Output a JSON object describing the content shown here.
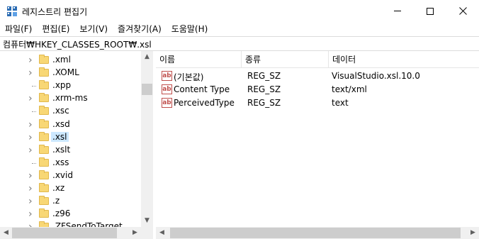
{
  "window": {
    "title": "레지스트리 편집기",
    "icon": "registry-editor-icon"
  },
  "menu": [
    "파일(F)",
    "편집(E)",
    "보기(V)",
    "즐겨찾기(A)",
    "도움말(H)"
  ],
  "address": "컴퓨터₩HKEY_CLASSES_ROOT₩.xsl",
  "tree": {
    "items": [
      {
        "label": ".xml",
        "expandable": true,
        "selected": false
      },
      {
        "label": ".XOML",
        "expandable": true,
        "selected": false
      },
      {
        "label": ".xpp",
        "expandable": false,
        "selected": false
      },
      {
        "label": ".xrm-ms",
        "expandable": true,
        "selected": false
      },
      {
        "label": ".xsc",
        "expandable": false,
        "selected": false
      },
      {
        "label": ".xsd",
        "expandable": true,
        "selected": false
      },
      {
        "label": ".xsl",
        "expandable": true,
        "selected": true
      },
      {
        "label": ".xslt",
        "expandable": true,
        "selected": false
      },
      {
        "label": ".xss",
        "expandable": false,
        "selected": false
      },
      {
        "label": ".xvid",
        "expandable": true,
        "selected": false
      },
      {
        "label": ".xz",
        "expandable": true,
        "selected": false
      },
      {
        "label": ".z",
        "expandable": true,
        "selected": false
      },
      {
        "label": ".z96",
        "expandable": true,
        "selected": false
      },
      {
        "label": ".ZFSendToTarget",
        "expandable": true,
        "selected": false
      }
    ]
  },
  "list": {
    "headers": {
      "name": "이름",
      "type": "종류",
      "data": "데이터"
    },
    "rows": [
      {
        "name": "(기본값)",
        "type": "REG_SZ",
        "data": "VisualStudio.xsl.10.0"
      },
      {
        "name": "Content Type",
        "type": "REG_SZ",
        "data": "text/xml"
      },
      {
        "name": "PerceivedType",
        "type": "REG_SZ",
        "data": "text"
      }
    ]
  },
  "icons": {
    "value_icon_text": "ab"
  }
}
